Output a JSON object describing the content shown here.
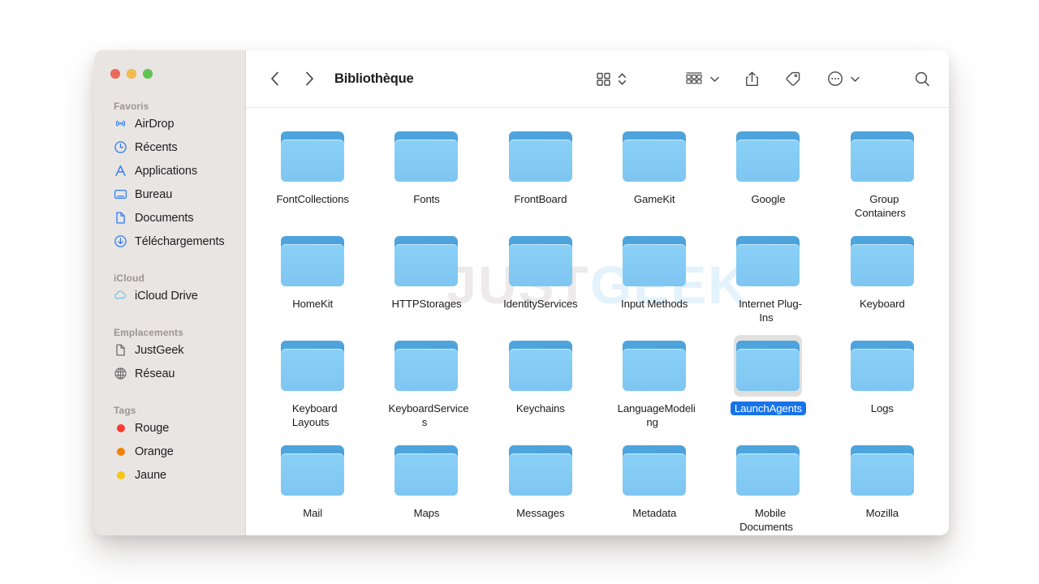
{
  "window": {
    "traffic_lights": [
      {
        "name": "close",
        "color": "#ee6a5f"
      },
      {
        "name": "minimize",
        "color": "#f5bd4f"
      },
      {
        "name": "zoom",
        "color": "#61c454"
      }
    ]
  },
  "toolbar": {
    "back_label": "‹",
    "forward_label": "›",
    "title": "Bibliothèque",
    "items": [
      {
        "icon": "grid-view-icon",
        "label": ""
      },
      {
        "icon": "view-sort-chevron-icon",
        "label": ""
      },
      {
        "icon": "group-by-icon",
        "label": ""
      },
      {
        "icon": "chevron-down-icon",
        "label": ""
      },
      {
        "icon": "share-icon",
        "label": ""
      },
      {
        "icon": "tag-icon",
        "label": ""
      },
      {
        "icon": "more-ellipsis-icon",
        "label": ""
      },
      {
        "icon": "chevron-down-icon",
        "label": ""
      },
      {
        "icon": "search-icon",
        "label": ""
      }
    ]
  },
  "sidebar": {
    "sections": [
      {
        "title": "Favoris",
        "items": [
          {
            "label": "AirDrop",
            "icon": "airdrop-icon"
          },
          {
            "label": "Récents",
            "icon": "clock-icon"
          },
          {
            "label": "Applications",
            "icon": "applications-icon"
          },
          {
            "label": "Bureau",
            "icon": "desktop-icon"
          },
          {
            "label": "Documents",
            "icon": "document-icon"
          },
          {
            "label": "Téléchargements",
            "icon": "downloads-icon"
          }
        ]
      },
      {
        "title": "iCloud",
        "items": [
          {
            "label": "iCloud Drive",
            "icon": "cloud-icon"
          }
        ]
      },
      {
        "title": "Emplacements",
        "items": [
          {
            "label": "JustGeek",
            "icon": "disk-document-icon"
          },
          {
            "label": "Réseau",
            "icon": "network-globe-icon"
          }
        ]
      },
      {
        "title": "Tags",
        "items": [
          {
            "label": "Rouge",
            "icon": "tag-dot-icon",
            "color": "#ff3b30"
          },
          {
            "label": "Orange",
            "icon": "tag-dot-icon",
            "color": "#f08306"
          },
          {
            "label": "Jaune",
            "icon": "tag-dot-icon",
            "color": "#f5c518"
          }
        ]
      }
    ]
  },
  "watermark": {
    "part1": "JUST",
    "part2": "GEEK",
    "color1": "#eceaea",
    "color2": "#e3f2fb"
  },
  "main": {
    "selected_item": "LaunchAgents",
    "selection_color": "#1873e8",
    "items": [
      {
        "name": "FontCollections",
        "icon": "folder-icon",
        "selected": false
      },
      {
        "name": "Fonts",
        "icon": "folder-icon",
        "selected": false
      },
      {
        "name": "FrontBoard",
        "icon": "folder-icon",
        "selected": false
      },
      {
        "name": "GameKit",
        "icon": "folder-icon",
        "selected": false
      },
      {
        "name": "Google",
        "icon": "folder-icon",
        "selected": false
      },
      {
        "name": "Group Containers",
        "icon": "folder-icon",
        "selected": false
      },
      {
        "name": "HomeKit",
        "icon": "folder-icon",
        "selected": false
      },
      {
        "name": "HTTPStorages",
        "icon": "folder-icon",
        "selected": false
      },
      {
        "name": "IdentityServices",
        "icon": "folder-icon",
        "selected": false
      },
      {
        "name": "Input Methods",
        "icon": "folder-icon",
        "selected": false
      },
      {
        "name": "Internet Plug-Ins",
        "icon": "folder-icon",
        "selected": false
      },
      {
        "name": "Keyboard",
        "icon": "folder-icon",
        "selected": false
      },
      {
        "name": "Keyboard Layouts",
        "icon": "folder-icon",
        "selected": false
      },
      {
        "name": "KeyboardServices",
        "icon": "folder-icon",
        "selected": false
      },
      {
        "name": "Keychains",
        "icon": "folder-icon",
        "selected": false
      },
      {
        "name": "LanguageModeling",
        "icon": "folder-icon",
        "selected": false
      },
      {
        "name": "LaunchAgents",
        "icon": "folder-icon",
        "selected": true
      },
      {
        "name": "Logs",
        "icon": "folder-icon",
        "selected": false
      },
      {
        "name": "Mail",
        "icon": "folder-icon",
        "selected": false
      },
      {
        "name": "Maps",
        "icon": "folder-icon",
        "selected": false
      },
      {
        "name": "Messages",
        "icon": "folder-icon",
        "selected": false
      },
      {
        "name": "Metadata",
        "icon": "folder-icon",
        "selected": false
      },
      {
        "name": "Mobile Documents",
        "icon": "folder-icon",
        "selected": false
      },
      {
        "name": "Mozilla",
        "icon": "folder-icon",
        "selected": false
      }
    ]
  }
}
